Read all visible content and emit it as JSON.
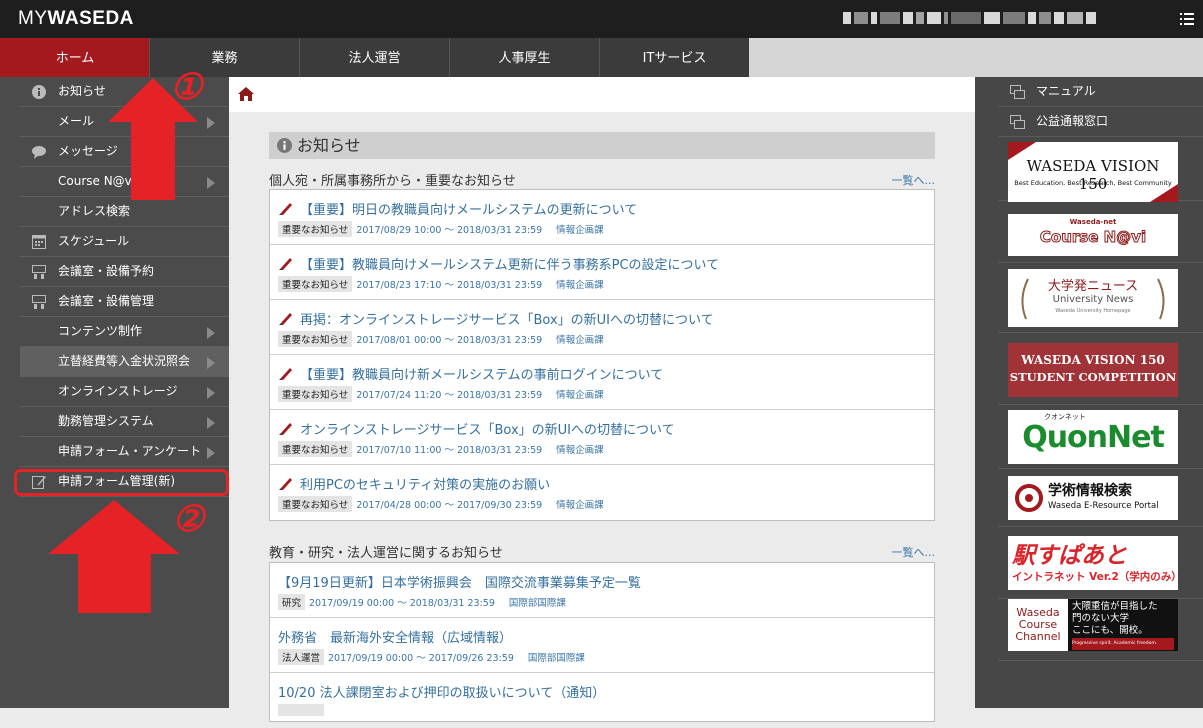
{
  "header": {
    "logo_my": "MY",
    "logo_waseda": "WASEDA"
  },
  "nav": {
    "tabs": [
      {
        "label": "ホーム",
        "active": true
      },
      {
        "label": "業務"
      },
      {
        "label": "法人運営"
      },
      {
        "label": "人事厚生"
      },
      {
        "label": "ITサービス"
      }
    ]
  },
  "sidebar": {
    "items": [
      {
        "label": "お知らせ",
        "icon": "info-icon"
      },
      {
        "label": "メール",
        "arrow": true
      },
      {
        "label": "メッセージ",
        "icon": "speech-bubble-icon"
      },
      {
        "label": "Course N@vi",
        "arrow": true
      },
      {
        "label": "アドレス検索"
      },
      {
        "label": "スケジュール",
        "icon": "calendar-icon"
      },
      {
        "label": "会議室・設備予約",
        "icon": "room-icon"
      },
      {
        "label": "会議室・設備管理",
        "icon": "room-icon"
      },
      {
        "label": "コンテンツ制作",
        "arrow": true
      },
      {
        "label": "立替経費等入金状況照会",
        "arrow": true,
        "highlight": true
      },
      {
        "label": "オンラインストレージ",
        "arrow": true
      },
      {
        "label": "勤務管理システム",
        "arrow": true
      },
      {
        "label": "申請フォーム・アンケート",
        "arrow": true
      },
      {
        "label": "申請フォーム管理(新)",
        "icon": "edit-icon"
      }
    ]
  },
  "main": {
    "section_title": "お知らせ",
    "group1": {
      "title": "個人宛・所属事務所から・重要なお知らせ",
      "more": "一覧へ...",
      "items": [
        {
          "title": "【重要】明日の教職員向けメールシステムの更新について",
          "badge": "重要なお知らせ",
          "dates": "2017/08/29 10:00 ～ 2018/03/31 23:59",
          "dept": "情報企画課"
        },
        {
          "title": "【重要】教職員向けメールシステム更新に伴う事務系PCの設定について",
          "badge": "重要なお知らせ",
          "dates": "2017/08/23 17:10 ～ 2018/03/31 23:59",
          "dept": "情報企画課"
        },
        {
          "title": "再掲：オンラインストレージサービス「Box」の新UIへの切替について",
          "badge": "重要なお知らせ",
          "dates": "2017/08/01 00:00 ～ 2018/03/31 23:59",
          "dept": "情報企画課"
        },
        {
          "title": "【重要】教職員向け新メールシステムの事前ログインについて",
          "badge": "重要なお知らせ",
          "dates": "2017/07/24 11:20 ～ 2018/03/31 23:59",
          "dept": "情報企画課"
        },
        {
          "title": "オンラインストレージサービス「Box」の新UIへの切替について",
          "badge": "重要なお知らせ",
          "dates": "2017/07/10 11:00 ～ 2018/03/31 23:59",
          "dept": "情報企画課"
        },
        {
          "title": "利用PCのセキュリティ対策の実施のお願い",
          "badge": "重要なお知らせ",
          "dates": "2017/04/28 00:00 ～ 2017/09/30 23:59",
          "dept": "情報企画課"
        }
      ]
    },
    "group2": {
      "title": "教育・研究・法人運営に関するお知らせ",
      "more": "一覧へ...",
      "items": [
        {
          "title": "【9月19日更新】日本学術振興会　国際交流事業募集予定一覧",
          "badge": "研究",
          "dates": "2017/09/19 00:00 ～ 2018/03/31 23:59",
          "dept": "国際部国際課"
        },
        {
          "title": "外務省　最新海外安全情報（広域情報）",
          "badge": "法人運営",
          "dates": "2017/09/19 00:00 ～ 2017/09/26 23:59",
          "dept": "国際部国際課"
        },
        {
          "title": "10/20 法人課閉室および押印の取扱いについて（通知）",
          "badge": "",
          "dates": "",
          "dept": ""
        }
      ]
    }
  },
  "right": {
    "links": [
      {
        "label": "マニュアル"
      },
      {
        "label": "公益通報窓口"
      }
    ],
    "banners": {
      "vision": {
        "l1": "WASEDA VISION 150",
        "l2": "Best Education, Best Research, Best Community"
      },
      "coursenavi": {
        "l1": "Waseda-net",
        "l2": "Course N@vi"
      },
      "news": {
        "l1": "大学発ニュース",
        "l2": "University News",
        "l3": "Waseda University Homepage"
      },
      "competition": {
        "l1": "WASEDA VISION 150",
        "l2": "STUDENT COMPETITION"
      },
      "quon": {
        "l1": "クオンネット",
        "l2": "QuonNet"
      },
      "gakujutsu": {
        "l1": "学術情報検索",
        "l2": "Waseda E-Resource Portal"
      },
      "ekisupa": {
        "l1": "駅すぱあと",
        "l2": "イントラネット Ver.2（学内のみ）"
      },
      "channel": {
        "l1": "Waseda",
        "l2": "Course",
        "l3": "Channel",
        "r1": "大隈重信が目指した",
        "r2": "門のない大学",
        "r3": "ここにも、開校。",
        "r4": "Progressive spirit. Academic freedom."
      }
    }
  },
  "annotations": {
    "one": "①",
    "two": "②"
  },
  "colors": {
    "accent": "#a3191d",
    "link": "#34709f",
    "sidebar": "#4b4b4b",
    "annotation": "#e52226"
  }
}
